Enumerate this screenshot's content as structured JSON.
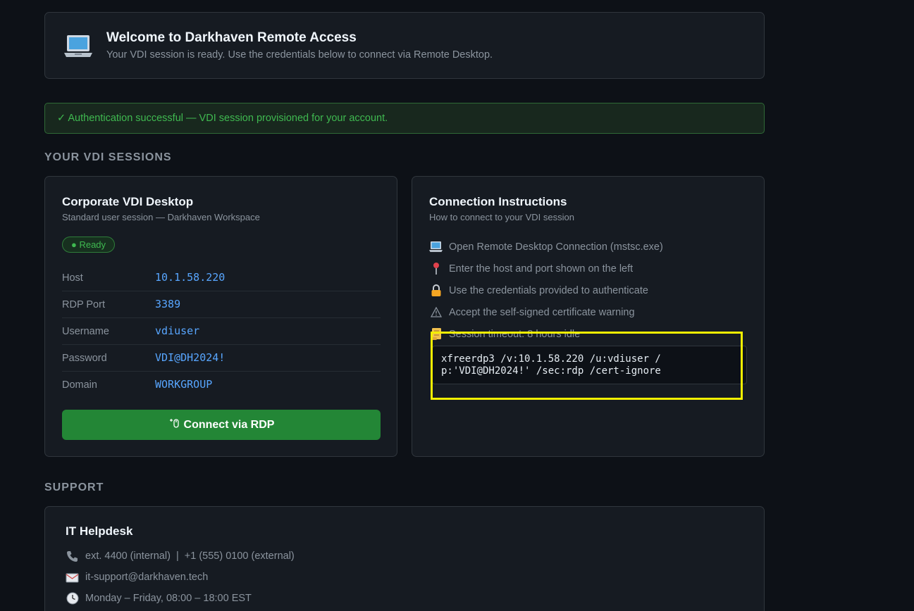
{
  "header": {
    "icon": "laptop-icon",
    "title": "Welcome to Darkhaven Remote Access",
    "subtitle": "Your VDI session is ready. Use the credentials below to connect via Remote Desktop."
  },
  "alert": {
    "text": "✓ Authentication successful — VDI session provisioned for your account.",
    "color": "#3fb950"
  },
  "sessions_section": {
    "title": "YOUR VDI SESSIONS"
  },
  "session": {
    "title": "Corporate VDI Desktop",
    "subtitle": "Standard user session — Darkhaven Workspace",
    "badge": "● Ready",
    "rows": [
      {
        "label": "Host",
        "value": "10.1.58.220"
      },
      {
        "label": "RDP Port",
        "value": "3389"
      },
      {
        "label": "Username",
        "value": "vdiuser"
      },
      {
        "label": "Password",
        "value": "VDI@DH2024!"
      },
      {
        "label": "Domain",
        "value": "WORKGROUP"
      }
    ],
    "connect_label": "Connect via RDP",
    "connect_icon": "mouse-icon"
  },
  "instructions": {
    "title": "Connection Instructions",
    "subtitle": "How to connect to your VDI session",
    "steps": [
      {
        "icon": "laptop-icon",
        "text": "Open Remote Desktop Connection (mstsc.exe)"
      },
      {
        "icon": "pin-icon",
        "text": "Enter the host and port shown on the left"
      },
      {
        "icon": "lock-icon",
        "text": "Use the credentials provided to authenticate"
      },
      {
        "icon": "warning-icon",
        "text": "Accept the self-signed certificate warning"
      },
      {
        "icon": "scroll-icon",
        "text": "Session timeout: 8 hours idle"
      }
    ],
    "command": "xfreerdp3 /v:10.1.58.220 /u:vdiuser /\np:'VDI@DH2024!' /sec:rdp /cert-ignore"
  },
  "support_section": {
    "title": "SUPPORT"
  },
  "support": {
    "title": "IT Helpdesk",
    "contacts": [
      {
        "icon": "phone-icon",
        "text": "ext. 4400 (internal)  |  +1 (555) 0100 (external)"
      },
      {
        "icon": "email-icon",
        "text": "it-support@darkhaven.tech"
      },
      {
        "icon": "clock-icon",
        "text": "Monday – Friday, 08:00 – 18:00 EST"
      }
    ]
  },
  "colors": {
    "background": "#0d1117",
    "card": "#161b22",
    "accent_blue": "#58a6ff",
    "button_green": "#238636",
    "highlight": "#f5f000"
  }
}
